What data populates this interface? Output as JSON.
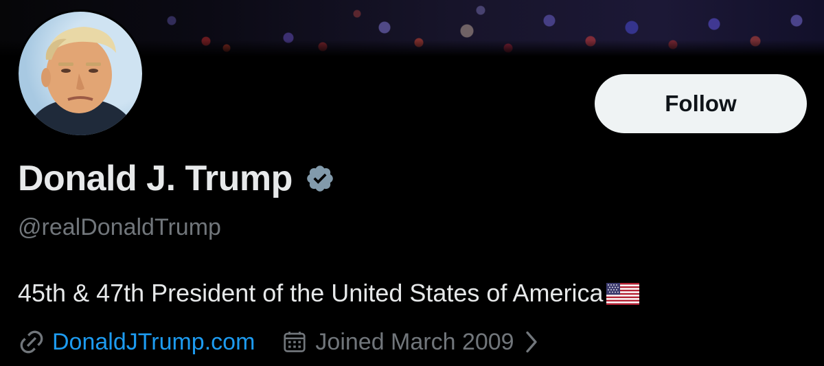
{
  "profile": {
    "display_name": "Donald J. Trump",
    "handle": "@realDonaldTrump",
    "bio": "45th & 47th President of the United States of America",
    "bio_emoji": "flag-usa-icon",
    "website": "DonaldJTrump.com",
    "joined": "Joined March 2009",
    "verified": true
  },
  "actions": {
    "follow_label": "Follow"
  },
  "icons": {
    "verified": "verified-badge-icon",
    "link": "link-icon",
    "calendar": "calendar-icon",
    "chevron": "chevron-right-icon"
  },
  "colors": {
    "background": "#000000",
    "primary_text": "#e7e9ea",
    "secondary_text": "#71767b",
    "link": "#1d9bf0",
    "verified_badge": "#829aab",
    "follow_bg": "#eff3f4",
    "follow_text": "#0f1419"
  }
}
